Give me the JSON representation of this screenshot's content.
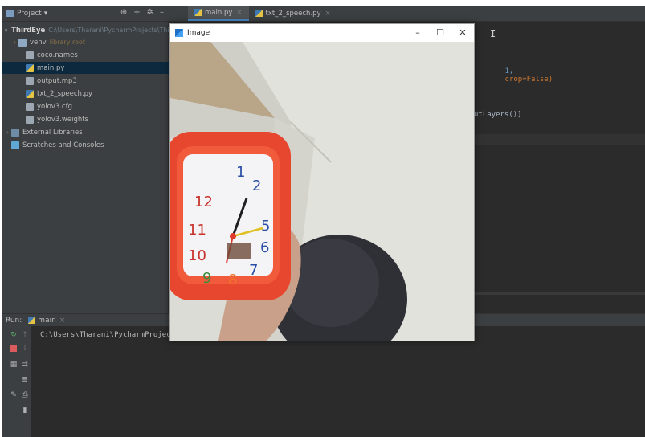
{
  "project_panel": {
    "title": "Project",
    "title_arrow": "▾",
    "tools": [
      "⊕",
      "÷",
      "✲",
      "–"
    ],
    "tree": [
      {
        "label": "ThirdEye",
        "path": "C:\\Users\\Tharani\\PycharmProjects\\ThirdEye",
        "arrow": "∨",
        "icon": "folder-icon"
      },
      {
        "label": "venv",
        "excluded": "library root",
        "arrow": "›",
        "icon": "folder-icon"
      },
      {
        "label": "coco.names",
        "icon": "file-icon"
      },
      {
        "label": "main.py",
        "icon": "python-file-icon",
        "selected": true
      },
      {
        "label": "output.mp3",
        "icon": "file-icon"
      },
      {
        "label": "txt_2_speech.py",
        "icon": "python-file-icon"
      },
      {
        "label": "yolov3.cfg",
        "icon": "file-icon"
      },
      {
        "label": "yolov3.weights",
        "icon": "file-icon"
      },
      {
        "label": "External Libraries",
        "arrow": "›",
        "icon": "library-icon"
      },
      {
        "label": "Scratches and Consoles",
        "icon": "scratch-icon"
      }
    ]
  },
  "editor": {
    "tabs": [
      {
        "label": "main.py",
        "close": "×",
        "active": true
      },
      {
        "label": "txt_2_speech.py",
        "close": "×",
        "active": false
      }
    ],
    "code_fragments": {
      "line_a_num": "1,",
      "line_a_kw": "crop",
      "line_a_rest": "=False)",
      "line_b": "utLayers()]"
    },
    "caret": "I"
  },
  "run_panel": {
    "label": "Run:",
    "tab": "main",
    "tab_close": "×",
    "console_line": "C:\\Users\\Tharani\\PycharmProjects\\T"
  },
  "image_window": {
    "title": "Image",
    "minimize": "–",
    "maximize": "☐",
    "close": "✕"
  },
  "colors": {
    "ide_bg": "#2b2b2b",
    "panel_bg": "#3c3f41",
    "selection": "#0d293e",
    "keyword_orange": "#cc7832",
    "clock_red": "#e8472f"
  }
}
